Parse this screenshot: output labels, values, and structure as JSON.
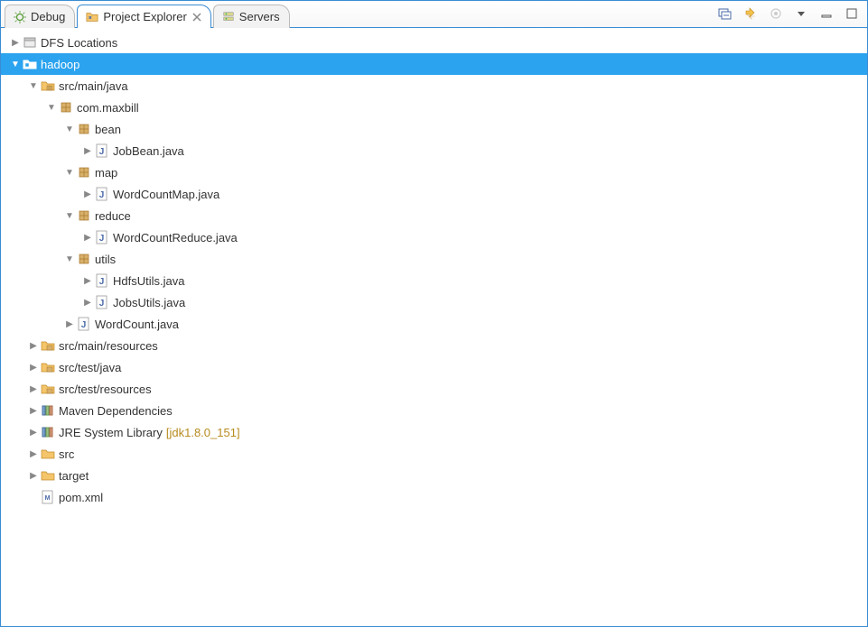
{
  "tabs": {
    "debug": "Debug",
    "project_explorer": "Project Explorer",
    "servers": "Servers"
  },
  "toolbar": {
    "collapse_all": "Collapse All",
    "link_editor": "Link with Editor",
    "focus": "Focus on Active Task",
    "menu": "View Menu",
    "minimize": "Minimize",
    "maximize": "Maximize"
  },
  "tree": {
    "dfs": "DFS Locations",
    "hadoop": "hadoop",
    "src_main_java": "src/main/java",
    "pkg_com_maxbill": "com.maxbill",
    "pkg_bean": "bean",
    "jobbean": "JobBean.java",
    "pkg_map": "map",
    "wordcountmap": "WordCountMap.java",
    "pkg_reduce": "reduce",
    "wordcountreduce": "WordCountReduce.java",
    "pkg_utils": "utils",
    "hdfsutils": "HdfsUtils.java",
    "jobsutils": "JobsUtils.java",
    "wordcount": "WordCount.java",
    "src_main_resources": "src/main/resources",
    "src_test_java": "src/test/java",
    "src_test_resources": "src/test/resources",
    "maven_deps": "Maven Dependencies",
    "jre_lib": "JRE System Library",
    "jre_decorator": "[jdk1.8.0_151]",
    "src": "src",
    "target": "target",
    "pom": "pom.xml"
  }
}
